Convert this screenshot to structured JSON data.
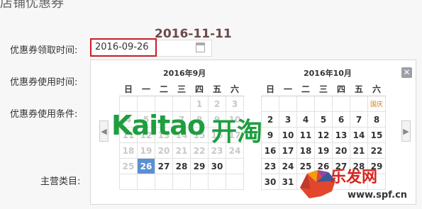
{
  "header": {
    "title": "店铺优惠券"
  },
  "annotation": {
    "date": "2016-11-11"
  },
  "form": {
    "labels": {
      "receive_time": "优惠券领取时间:",
      "use_time": "优惠券使用时间:",
      "use_condition": "优惠券使用条件:",
      "category": "主营类目:"
    },
    "date_value": "2016-09-26"
  },
  "datepicker": {
    "close_label": "✕",
    "prev_label": "◀",
    "next_label": "▶",
    "weekdays": [
      "日",
      "一",
      "二",
      "三",
      "四",
      "五",
      "六"
    ],
    "months": [
      {
        "title": "2016年9月",
        "rows": [
          [
            "",
            "",
            "",
            "",
            "1",
            "2",
            "3"
          ],
          [
            "4",
            "5",
            "6",
            "7",
            "8",
            "9",
            "10"
          ],
          [
            "11",
            "12",
            "13",
            "14",
            "15",
            "16",
            "17"
          ],
          [
            "18",
            "19",
            "20",
            "21",
            "22",
            "23",
            "24"
          ],
          [
            "25",
            "26",
            "27",
            "28",
            "29",
            "30",
            ""
          ],
          [
            "",
            "",
            "",
            "",
            "",
            "",
            ""
          ]
        ]
      },
      {
        "title": "2016年10月",
        "rows": [
          [
            "",
            "",
            "",
            "",
            "",
            "",
            "国庆"
          ],
          [
            "2",
            "3",
            "4",
            "5",
            "6",
            "7",
            "8"
          ],
          [
            "9",
            "10",
            "11",
            "12",
            "13",
            "14",
            "15"
          ],
          [
            "16",
            "17",
            "18",
            "19",
            "20",
            "21",
            "22"
          ],
          [
            "23",
            "24",
            "25",
            "26",
            "27",
            "28",
            "29"
          ],
          [
            "30",
            "31",
            "",
            "",
            "",
            "",
            ""
          ]
        ]
      }
    ]
  },
  "watermarks": {
    "kaitao_latin": "Kaitao",
    "kaitao_cn": "开淘",
    "site_name": "乐发网",
    "site_url": "www.spf.cn"
  },
  "colors": {
    "accent": "#5b8fd4",
    "input_border": "#c51e25",
    "logo_green": "#1e9e3f",
    "watermark_red": "#d7261f"
  }
}
